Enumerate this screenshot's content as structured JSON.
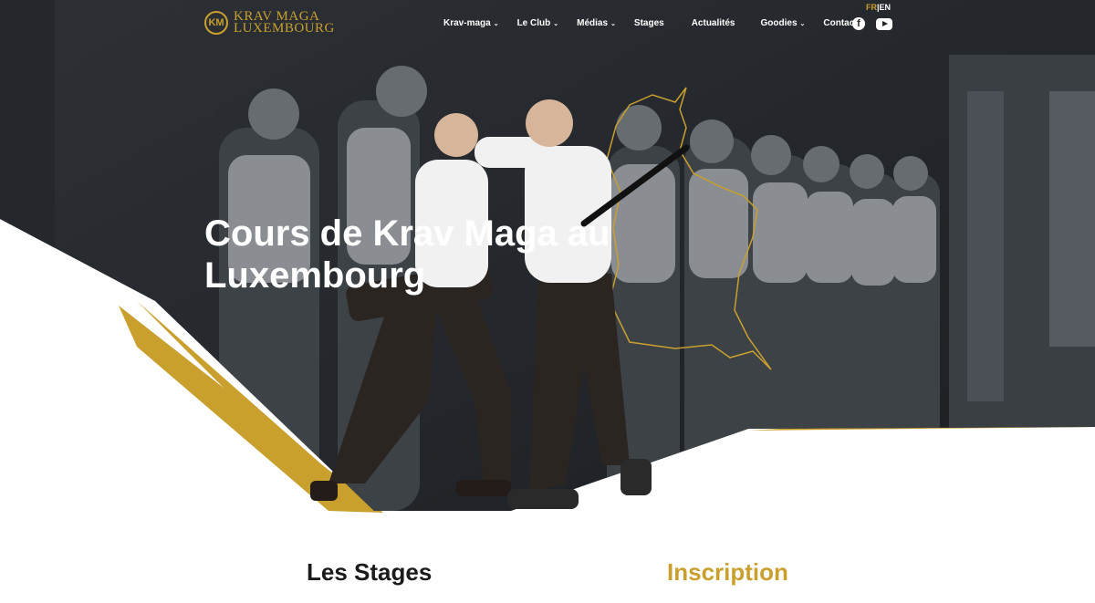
{
  "brand": {
    "line1": "KRAV MAGA",
    "line2": "LUXEMBOURG",
    "accent_color": "#c9a02e"
  },
  "nav": {
    "items": [
      {
        "label": "Krav-maga",
        "dropdown": true
      },
      {
        "label": "Le Club",
        "dropdown": true
      },
      {
        "label": "Médias",
        "dropdown": true
      },
      {
        "label": "Stages",
        "dropdown": false
      },
      {
        "label": "Actualités",
        "dropdown": false
      },
      {
        "label": "Goodies",
        "dropdown": true
      },
      {
        "label": "Contact",
        "dropdown": false
      }
    ]
  },
  "lang": {
    "fr": "FR",
    "sep": "|",
    "en": "EN",
    "active": "FR"
  },
  "social": {
    "icons": [
      "facebook-icon",
      "youtube-icon"
    ]
  },
  "hero": {
    "title_line1": "Cours de Krav Maga au",
    "title_line2": "Luxembourg"
  },
  "sections": {
    "stages_title": "Les Stages",
    "inscription_title": "Inscription"
  }
}
